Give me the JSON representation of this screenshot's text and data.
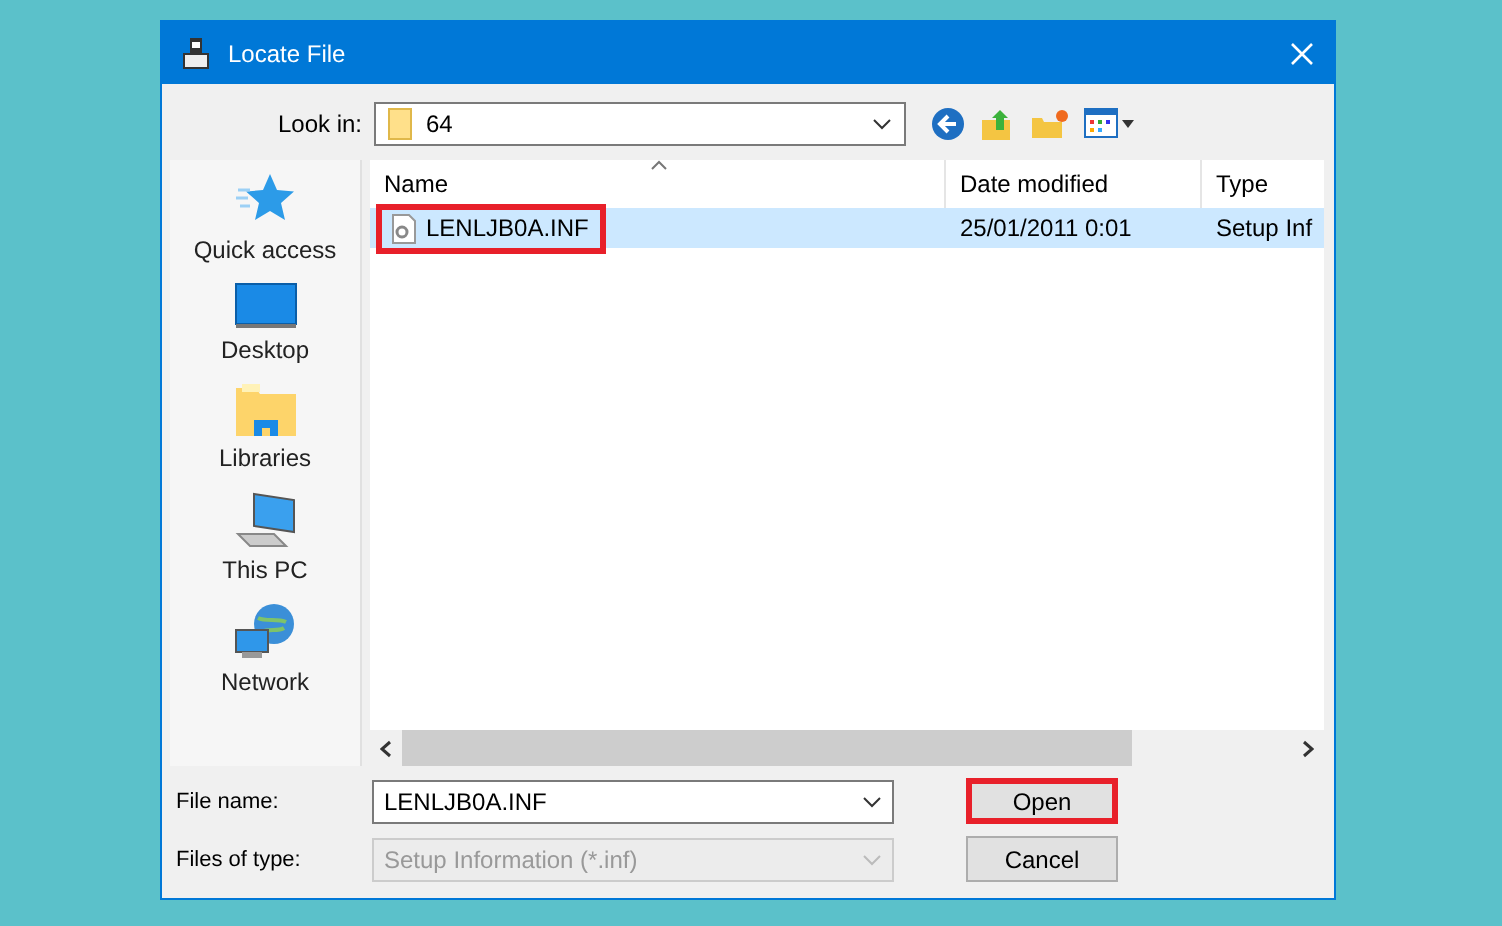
{
  "window": {
    "title": "Locate File"
  },
  "look_in": {
    "label": "Look in:",
    "value": "64"
  },
  "sidebar": {
    "items": [
      {
        "label": "Quick access",
        "kind": "star",
        "selected": false
      },
      {
        "label": "Desktop",
        "kind": "desktop",
        "selected": false
      },
      {
        "label": "Libraries",
        "kind": "libraries",
        "selected": false
      },
      {
        "label": "This PC",
        "kind": "pc",
        "selected": false
      },
      {
        "label": "Network",
        "kind": "network",
        "selected": false
      }
    ]
  },
  "table": {
    "columns": [
      "Name",
      "Date modified",
      "Type"
    ],
    "rows": [
      {
        "cells": [
          "LENLJB0A.INF",
          "25/01/2011 0:01",
          "Setup Inf"
        ],
        "selected": true,
        "highlighted": true
      }
    ]
  },
  "file_name": {
    "label": "File name:",
    "value": "LENLJB0A.INF"
  },
  "file_type": {
    "label": "Files of type:",
    "value": "Setup Information (*.inf)",
    "disabled": true
  },
  "buttons": [
    {
      "label": "Open",
      "highlighted": true
    },
    {
      "label": "Cancel",
      "highlighted": false
    }
  ]
}
